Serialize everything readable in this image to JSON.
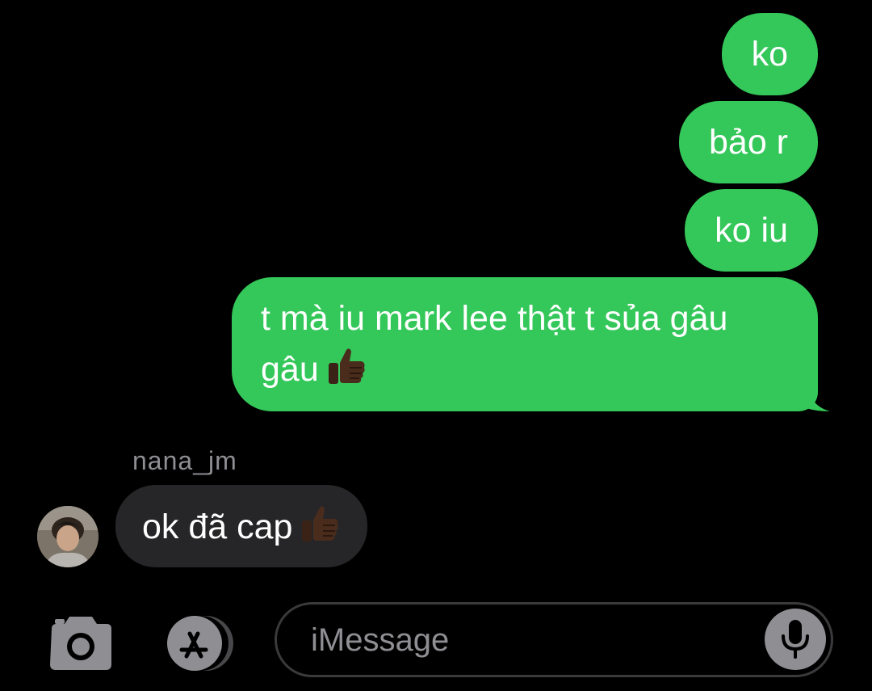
{
  "conversation": {
    "messages": [
      {
        "direction": "outgoing",
        "text": "ko"
      },
      {
        "direction": "outgoing",
        "text": "bảo r"
      },
      {
        "direction": "outgoing",
        "text": "ko iu"
      },
      {
        "direction": "outgoing",
        "text": "t mà iu mark lee thật t sủa gâu gâu",
        "emoji": "thumbs-up"
      },
      {
        "direction": "incoming",
        "sender": "nana_jm",
        "text": "ok đã cap",
        "emoji": "thumbs-up"
      }
    ]
  },
  "composer": {
    "placeholder": "iMessage",
    "icons": [
      "camera-icon",
      "app-store-icon",
      "microphone-icon"
    ]
  },
  "colors": {
    "outgoing_bubble": "#34c759",
    "incoming_bubble": "#262628",
    "background": "#000000",
    "secondary_text": "#8e8e93"
  }
}
